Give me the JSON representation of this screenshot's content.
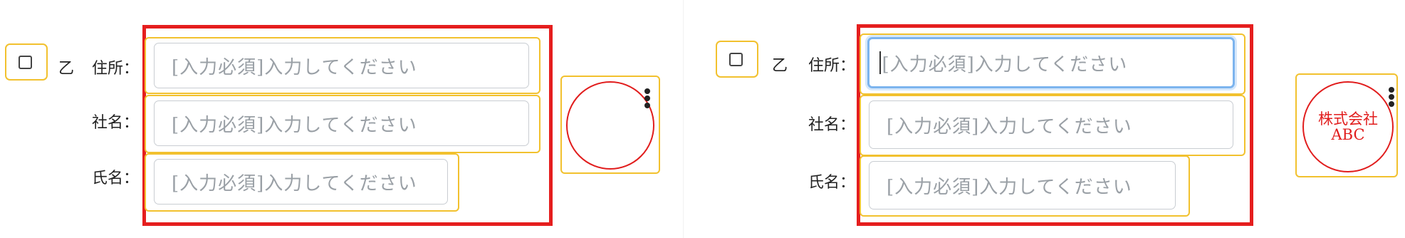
{
  "party_label": "乙",
  "fields": {
    "address_label": "住所：",
    "company_label": "社名：",
    "name_label": "氏名："
  },
  "placeholder": "[入力必須]入力してください",
  "seal_text_line1": "株式会社",
  "seal_text_line2": "ABC",
  "colors": {
    "highlight_frame": "#e51e1e",
    "field_outline": "#f2c12e",
    "seal": "#e11d1d",
    "focus": "#7cb4ee"
  }
}
